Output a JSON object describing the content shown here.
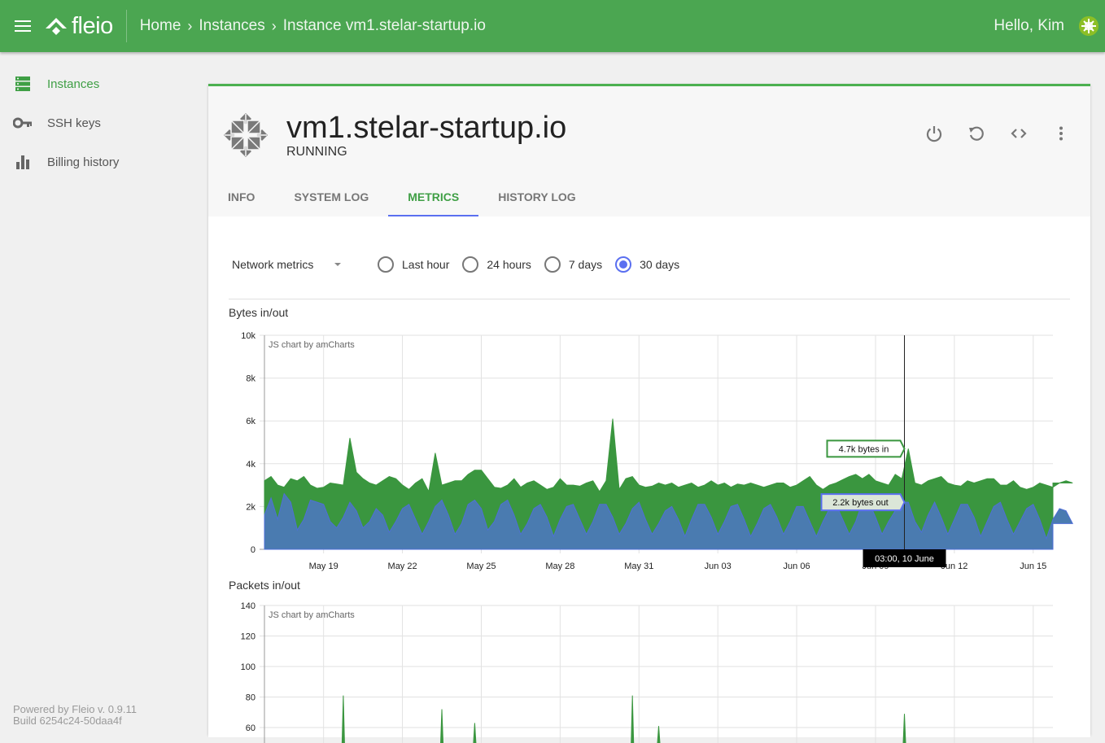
{
  "topbar": {
    "brand": "fleio",
    "breadcrumbs": [
      "Home",
      "Instances",
      "Instance vm1.stelar-startup.io"
    ],
    "greeting": "Hello, Kim"
  },
  "sidebar": {
    "items": [
      {
        "label": "Instances",
        "icon": "server-icon",
        "active": true
      },
      {
        "label": "SSH keys",
        "icon": "key-icon",
        "active": false
      },
      {
        "label": "Billing history",
        "icon": "bar-chart-icon",
        "active": false
      }
    ],
    "footer": [
      "Powered by Fleio v. 0.9.11",
      "Build 6254c24-50daa4f"
    ]
  },
  "instance": {
    "name": "vm1.stelar-startup.io",
    "status": "RUNNING",
    "actions": [
      "power-icon",
      "restart-icon",
      "console-icon",
      "more-vert-icon"
    ],
    "tabs": [
      "INFO",
      "SYSTEM LOG",
      "METRICS",
      "HISTORY LOG"
    ],
    "active_tab": "METRICS"
  },
  "metrics": {
    "select_value": "Network metrics",
    "ranges": [
      "Last hour",
      "24 hours",
      "7 days",
      "30 days"
    ],
    "selected_range": "30 days",
    "watermark": "JS chart by amCharts"
  },
  "colors": {
    "topbar": "#4ba651",
    "active": "#3f9f45",
    "accent": "#5a6ff0",
    "bytes_in": "#3a963f",
    "bytes_out": "#4a7bb0"
  },
  "chart_data": [
    {
      "type": "area",
      "title": "Bytes in/out",
      "x_start": "May 16 18:00",
      "x_step_hours": 6,
      "x_ticks": [
        "May 19",
        "May 22",
        "May 25",
        "May 28",
        "May 31",
        "Jun 03",
        "Jun 06",
        "Jun 09",
        "Jun 12",
        "Jun 15"
      ],
      "y_ticks": [
        "0",
        "2k",
        "4k",
        "6k",
        "8k",
        "10k"
      ],
      "ylim": [
        0,
        10000
      ],
      "grid": true,
      "series": [
        {
          "name": "bytes in",
          "color": "#3a963f",
          "values": [
            3200,
            3400,
            3000,
            2900,
            3300,
            3200,
            3400,
            3000,
            2850,
            2900,
            3100,
            3050,
            3000,
            5200,
            3600,
            3300,
            3100,
            3000,
            3200,
            3400,
            3300,
            3000,
            2800,
            3100,
            3300,
            2700,
            4500,
            3000,
            3100,
            3200,
            3200,
            3500,
            3700,
            3700,
            3300,
            2900,
            2850,
            3000,
            3300,
            2900,
            3100,
            3200,
            3000,
            2800,
            2900,
            3300,
            3000,
            3000,
            2950,
            3100,
            3200,
            2700,
            3200,
            6100,
            2800,
            3300,
            3400,
            3000,
            2900,
            2950,
            3100,
            3000,
            3100,
            2900,
            3000,
            3100,
            2900,
            3000,
            3200,
            3000,
            3100,
            2900,
            3050,
            3000,
            3100,
            3000,
            2900,
            3000,
            3100,
            3100,
            2900,
            3000,
            3200,
            3400,
            3000,
            2800,
            3000,
            3100,
            3250,
            3400,
            3500,
            3300,
            3500,
            3200,
            3100,
            3000,
            3500,
            3300,
            4700,
            3100,
            3000,
            3200,
            3300,
            3400,
            3100,
            3000,
            2950,
            3200,
            3100,
            3200,
            3300,
            3300,
            3000,
            3000,
            3200,
            2900,
            2800,
            2900,
            3100,
            3000,
            2900,
            3100,
            3200,
            3100
          ]
        },
        {
          "name": "bytes out",
          "color": "#4a7bb0",
          "values": [
            1600,
            2400,
            1400,
            2600,
            2200,
            900,
            1400,
            2300,
            2200,
            2100,
            1300,
            1000,
            1500,
            2200,
            1800,
            1000,
            1300,
            1900,
            1600,
            800,
            1300,
            1900,
            2100,
            1400,
            700,
            1300,
            2000,
            2300,
            1600,
            700,
            1200,
            2100,
            2300,
            1900,
            900,
            1300,
            2100,
            2300,
            1600,
            700,
            1200,
            1900,
            2100,
            1500,
            600,
            1400,
            2000,
            2100,
            1400,
            700,
            1300,
            2100,
            2100,
            1500,
            700,
            1200,
            1900,
            2200,
            1400,
            700,
            1200,
            1800,
            2000,
            1400,
            600,
            1400,
            2100,
            2100,
            1500,
            700,
            1300,
            2000,
            2100,
            1400,
            600,
            1200,
            1900,
            2100,
            1500,
            700,
            1300,
            2000,
            2000,
            1300,
            600,
            1300,
            1900,
            2100,
            1400,
            700,
            1300,
            2200,
            2200,
            1500,
            700,
            1300,
            1800,
            2200,
            2200,
            1300,
            800,
            1600,
            2200,
            1500,
            700,
            1400,
            2100,
            2100,
            1500,
            600,
            1300,
            2000,
            2200,
            1400,
            700,
            1300,
            1900,
            2100,
            1400,
            500,
            1400,
            1900,
            1800,
            1200
          ]
        }
      ],
      "annotations": {
        "cursor_label": "03:00, 10 June",
        "balloon_in": "4.7k bytes in",
        "balloon_out": "2.2k bytes out"
      }
    },
    {
      "type": "area",
      "title": "Packets in/out",
      "y_ticks": [
        "60",
        "80",
        "100",
        "120",
        "140"
      ],
      "ylim_visible": [
        60,
        140
      ],
      "grid": true,
      "series": [
        {
          "name": "packets in",
          "color": "#3a963f",
          "spikes": [
            {
              "x": "May 19 18:00",
              "value": 81
            },
            {
              "x": "May 23 12:00",
              "value": 72
            },
            {
              "x": "May 24 18:00",
              "value": 63
            },
            {
              "x": "May 30 18:00",
              "value": 81
            },
            {
              "x": "May 31 18:00",
              "value": 61
            },
            {
              "x": "Jun 10 03:00",
              "value": 69
            }
          ]
        }
      ]
    }
  ]
}
